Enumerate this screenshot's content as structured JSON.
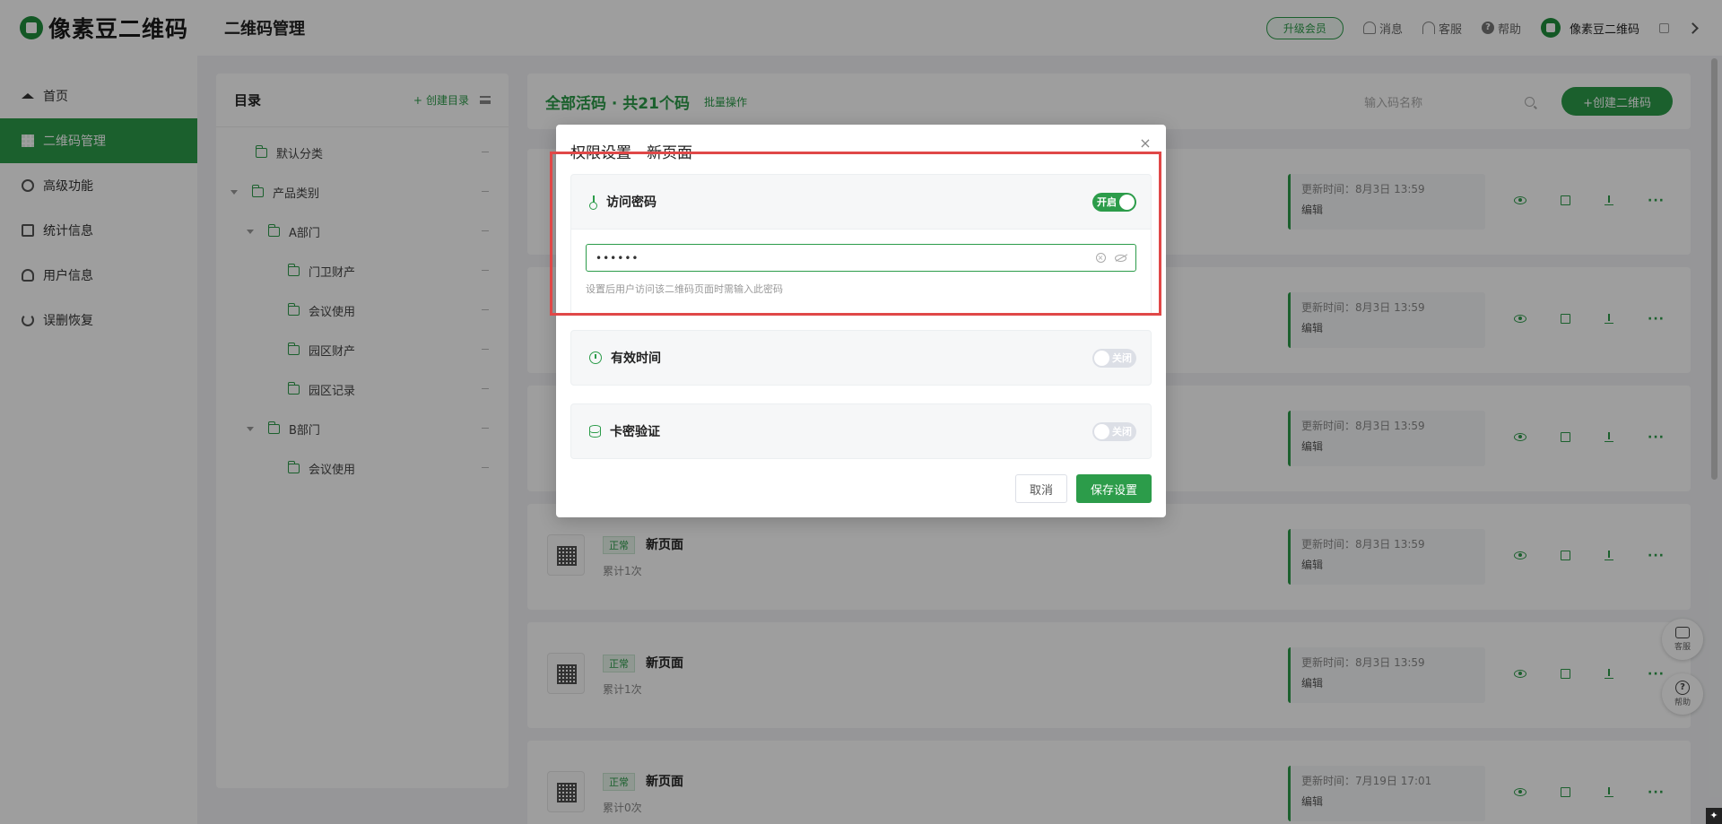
{
  "brand": {
    "name": "像素豆二维码",
    "color": "#2c9c4a"
  },
  "header": {
    "title": "二维码管理",
    "upgrade_label": "升级会员",
    "messages_label": "消息",
    "service_label": "客服",
    "help_label": "帮助",
    "user_name": "像素豆二维码"
  },
  "sidebar": {
    "items": [
      {
        "label": "首页",
        "icon": "home-icon"
      },
      {
        "label": "二维码管理",
        "icon": "grid-icon",
        "active": true
      },
      {
        "label": "高级功能",
        "icon": "gear-icon"
      },
      {
        "label": "统计信息",
        "icon": "chart-icon"
      },
      {
        "label": "用户信息",
        "icon": "user-icon"
      },
      {
        "label": "误删恢复",
        "icon": "undo-icon"
      }
    ]
  },
  "directory": {
    "title": "目录",
    "create_label": "创建目录",
    "items": [
      {
        "label": "默认分类"
      },
      {
        "label": "产品类别"
      },
      {
        "label": "A部门"
      },
      {
        "label": "门卫财产"
      },
      {
        "label": "会议使用"
      },
      {
        "label": "园区财产"
      },
      {
        "label": "园区记录"
      },
      {
        "label": "B部门"
      },
      {
        "label": "会议使用"
      }
    ]
  },
  "main": {
    "title": "全部活码 · 共21个码",
    "bulk_label": "批量操作",
    "search_placeholder": "输入码名称",
    "create_label": "+创建二维码",
    "cards": [
      {
        "update_time": "更新时间：8月3日 13:59",
        "edit_label": "编辑"
      },
      {
        "update_time": "更新时间：8月3日 13:59",
        "edit_label": "编辑"
      },
      {
        "update_time": "更新时间：8月3日 13:59",
        "edit_label": "编辑"
      },
      {
        "status": "正常",
        "name": "新页面",
        "count": "累计1次",
        "update_time": "更新时间：8月3日 13:59",
        "edit_label": "编辑"
      },
      {
        "status": "正常",
        "name": "新页面",
        "count": "累计1次",
        "update_time": "更新时间：8月3日 13:59",
        "edit_label": "编辑"
      },
      {
        "status": "正常",
        "name": "新页面",
        "count": "累计0次",
        "update_time": "更新时间：7月19日 17:01",
        "edit_label": "编辑"
      }
    ]
  },
  "floating": {
    "service_label": "客服",
    "help_label": "帮助"
  },
  "modal": {
    "title": "权限设置 - 新页面",
    "password": {
      "label": "访问密码",
      "toggle_label": "开启",
      "value": "••••••",
      "hint": "设置后用户访问该二维码页面时需输入此密码"
    },
    "valid_time": {
      "label": "有效时间",
      "toggle_label": "关闭"
    },
    "card_verify": {
      "label": "卡密验证",
      "toggle_label": "关闭"
    },
    "cancel_label": "取消",
    "save_label": "保存设置"
  }
}
